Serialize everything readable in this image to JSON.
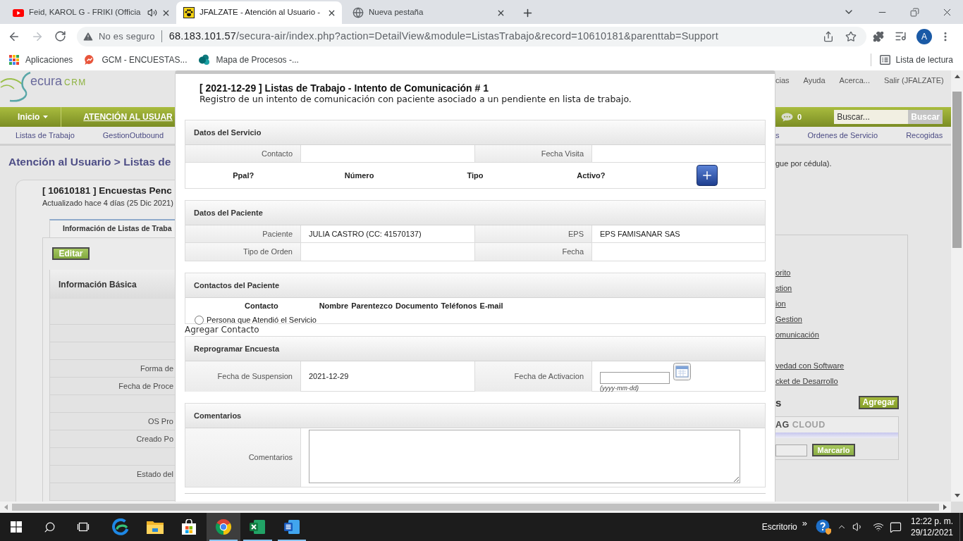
{
  "browser": {
    "tabs": [
      {
        "title": "Feid, KAROL G - FRIKI (Officia",
        "kind": "video",
        "audio": true,
        "selected": false
      },
      {
        "title": "JFALZATE - Atención al Usuario -",
        "kind": "paw",
        "audio": false,
        "selected": true
      },
      {
        "title": "Nueva pestaña",
        "kind": "globe",
        "audio": false,
        "selected": false
      }
    ],
    "security_label": "No es seguro",
    "url": {
      "host": "68.183.101.57",
      "path": "/secura-air/index.php?action=DetailView&module=ListasTrabajo&record=10610181&parenttab=Support"
    },
    "forward_disabled": true,
    "profile_initial": "A",
    "bookmarks": [
      {
        "label": "Aplicaciones",
        "kind": "apps"
      },
      {
        "label": "GCM - ENCUESTAS...",
        "kind": "bubble"
      },
      {
        "label": "Mapa de Procesos -...",
        "kind": "circles"
      }
    ],
    "reading_list": "Lista de lectura"
  },
  "crm": {
    "logo": {
      "name": "ecura",
      "suffix": "CRM"
    },
    "top_links": [
      "cias",
      "Ayuda",
      "Acerca...",
      "Salir (JFALZATE)"
    ],
    "nav": [
      {
        "label": "Inicio",
        "dropdown": true,
        "selected": false
      },
      {
        "label": "ATENCIÓN AL USUAR",
        "dropdown": false,
        "selected": true
      }
    ],
    "chat_count": "0",
    "search": {
      "placeholder": "Buscar...",
      "button": "Buscar"
    },
    "subnav_left": [
      "Listas de Trabajo",
      "GestionOutbound"
    ],
    "subnav_right": [
      "s",
      "Ordenes de Servicio",
      "Recogidas"
    ],
    "breadcrumb": "Atención al Usuario > Listas de",
    "note": "gue por cédula).",
    "record": {
      "title": "[ 10610181 ] Encuestas Penc",
      "updated": "Actualizado hace 4 días (25 Dic 2021)",
      "tab": "Información de Listas de Traba",
      "edit_button": "Editar",
      "block_title": "Información Básica",
      "rows": [
        {
          "kind": "blank"
        },
        {
          "kind": "blank"
        },
        {
          "kind": "blank"
        },
        {
          "kind": "field",
          "label": "Forma de"
        },
        {
          "kind": "field",
          "label": "Fecha de Proce"
        },
        {
          "kind": "blank"
        },
        {
          "kind": "field",
          "label": "OS Pro"
        },
        {
          "kind": "field",
          "label": "Creado Po"
        },
        {
          "kind": "blank"
        },
        {
          "kind": "field",
          "label": "Estado del"
        },
        {
          "kind": "blank"
        }
      ]
    },
    "side_link_groups": [
      [
        "orito",
        "stion",
        "ion",
        "Gestion",
        "omunicación"
      ],
      [
        "vedad con Software",
        "cket de Desarrollo"
      ]
    ],
    "tags_heading": "s",
    "add_button": "Agregar",
    "tag_cloud": {
      "lead": "AG",
      "rest": "CLOUD",
      "button": "Marcarlo"
    }
  },
  "modal": {
    "title": "[ 2021-12-29 ] Listas de Trabajo - Intento de Comunicación # 1",
    "subtitle": "Registro de un intento de comunicación con paciente asociado a un pendiente en lista de trabajo.",
    "sections": [
      {
        "kind": "fields",
        "title": "Datos del Servicio",
        "fields": [
          {
            "kind": "text",
            "label": "Contacto"
          },
          {
            "kind": "text",
            "label": "Fecha Visita"
          }
        ],
        "columns": [
          "Ppal?",
          "Número",
          "Tipo",
          "Activo?"
        ]
      },
      {
        "kind": "fields",
        "title": "Datos del Paciente",
        "fields": [
          {
            "kind": "text",
            "label": "Paciente",
            "value": "JULIA CASTRO (CC: 41570137)"
          },
          {
            "kind": "text",
            "label": "EPS",
            "value": "EPS FAMISANAR SAS"
          },
          {
            "kind": "text",
            "label": "Tipo de Orden"
          },
          {
            "kind": "text",
            "label": "Fecha"
          }
        ]
      },
      {
        "kind": "contacts",
        "title": "Contactos del Paciente",
        "columns": [
          "Contacto",
          "Nombre",
          "Parentezco",
          "Documento",
          "Teléfonos",
          "E-mail"
        ],
        "options": [
          {
            "label": "Persona que Atendió el Servicio",
            "selected": false
          }
        ],
        "after": "Agregar Contacto"
      },
      {
        "kind": "fields",
        "title": "Reprogramar Encuesta",
        "fields": [
          {
            "kind": "text",
            "label": "Fecha de Suspension",
            "value": "2021-12-29"
          },
          {
            "kind": "date",
            "label": "Fecha de Activacion",
            "hint": "(yyyy-mm-dd)"
          }
        ]
      },
      {
        "kind": "fields",
        "title": "Comentarios",
        "fields": [
          {
            "kind": "textarea",
            "label": "Comentarios"
          }
        ]
      }
    ]
  },
  "taskbar": {
    "system": [
      {
        "kind": "start"
      },
      {
        "kind": "search"
      },
      {
        "kind": "task_view"
      }
    ],
    "apps": [
      {
        "kind": "edge",
        "open": false,
        "selected": false
      },
      {
        "kind": "explorer",
        "open": false,
        "selected": false
      },
      {
        "kind": "store",
        "open": false,
        "selected": false
      },
      {
        "kind": "chrome",
        "open": true,
        "selected": true
      },
      {
        "kind": "excel",
        "open": true,
        "selected": false
      },
      {
        "kind": "word",
        "open": true,
        "selected": false
      }
    ],
    "desktop_label": "Escritorio",
    "overflow": "»",
    "tray": [
      {
        "kind": "help"
      },
      {
        "kind": "chevron"
      },
      {
        "kind": "volume"
      },
      {
        "kind": "wifi"
      },
      {
        "kind": "notifications"
      }
    ],
    "time": "12:22 p. m.",
    "date": "29/12/2021"
  }
}
